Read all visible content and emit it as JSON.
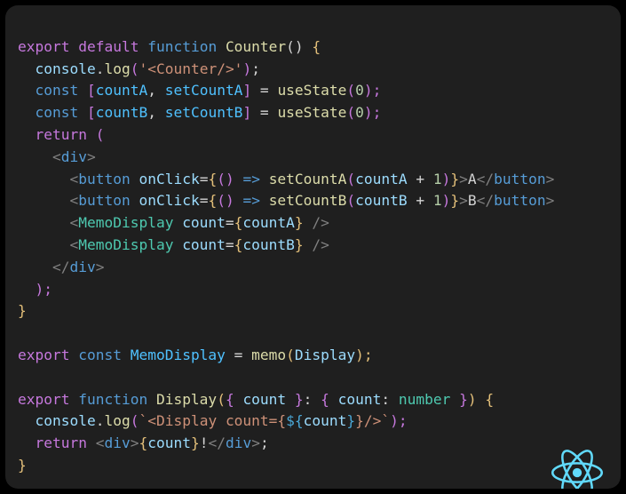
{
  "code": {
    "l1": {
      "export": "export",
      "default": "default",
      "function": "function",
      "name": "Counter",
      "paren": "()",
      "open": "{"
    },
    "l2": {
      "obj": "console",
      "dot": ".",
      "method": "log",
      "open": "(",
      "str": "'<Counter/>'",
      "close": ")",
      ";": ";"
    },
    "l3": {
      "const": "const",
      "lb": "[",
      "a": "countA",
      "comma": ", ",
      "b": "setCountA",
      "rb": "]",
      "eq": " = ",
      "call": "useState",
      "open": "(",
      "num": "0",
      "close": ");"
    },
    "l4": {
      "const": "const",
      "lb": "[",
      "a": "countB",
      "comma": ", ",
      "b": "setCountB",
      "rb": "]",
      "eq": " = ",
      "call": "useState",
      "open": "(",
      "num": "0",
      "close": ");"
    },
    "l5": {
      "return": "return",
      "open": " ("
    },
    "l6": {
      "open": "<",
      "tag": "div",
      "close": ">"
    },
    "l7": {
      "open": "<",
      "tag": "button",
      "sp": " ",
      "attr": "onClick",
      "eq": "=",
      "lb": "{",
      "p1": "()",
      "arrow": " => ",
      "fn": "setCountA",
      "lp": "(",
      "v": "countA",
      "plus": " + ",
      "one": "1",
      "rp": ")",
      "rb": "}",
      "gt": ">",
      "txt": "A",
      "lt2": "</",
      "tag2": "button",
      "gt2": ">"
    },
    "l8": {
      "open": "<",
      "tag": "button",
      "sp": " ",
      "attr": "onClick",
      "eq": "=",
      "lb": "{",
      "p1": "()",
      "arrow": " => ",
      "fn": "setCountB",
      "lp": "(",
      "v": "countB",
      "plus": " + ",
      "one": "1",
      "rp": ")",
      "rb": "}",
      "gt": ">",
      "txt": "B",
      "lt2": "</",
      "tag2": "button",
      "gt2": ">"
    },
    "l9": {
      "open": "<",
      "tag": "MemoDisplay",
      "sp": " ",
      "attr": "count",
      "eq": "=",
      "lb": "{",
      "v": "countA",
      "rb": "}",
      "close": " />"
    },
    "l10": {
      "open": "<",
      "tag": "MemoDisplay",
      "sp": " ",
      "attr": "count",
      "eq": "=",
      "lb": "{",
      "v": "countB",
      "rb": "}",
      "close": " />"
    },
    "l11": {
      "open": "</",
      "tag": "div",
      "close": ">"
    },
    "l12": {
      "close": ");"
    },
    "l13": {
      "close": "}"
    },
    "l15": {
      "export": "export",
      "const": "const",
      "name": "MemoDisplay",
      "eq": " = ",
      "call": "memo",
      "open": "(",
      "arg": "Display",
      "close": ");"
    },
    "l17": {
      "export": "export",
      "function": "function",
      "name": "Display",
      "open": "(",
      "lb": "{",
      "p": "count",
      "rb": " }",
      "colon": ": ",
      "lb2": "{ ",
      "p2": "count",
      "colon2": ": ",
      "type": "number",
      "rb2": " }",
      "close": ")",
      "open2": " {"
    },
    "l18": {
      "obj": "console",
      "dot": ".",
      "method": "log",
      "open": "(",
      "tick": "`<Display count={",
      "dollar": "${",
      "var": "count",
      "end": "}",
      "tail": "}/>`",
      "close": ");"
    },
    "l19": {
      "return": "return",
      "sp": " ",
      "lt": "<",
      "tag": "div",
      "gt": ">",
      "lb": "{",
      "v": "count",
      "rb": "}",
      "txt": "!",
      "lt2": "</",
      "tag2": "div",
      "gt2": ">",
      ";": ";"
    },
    "l20": {
      "close": "}"
    }
  }
}
